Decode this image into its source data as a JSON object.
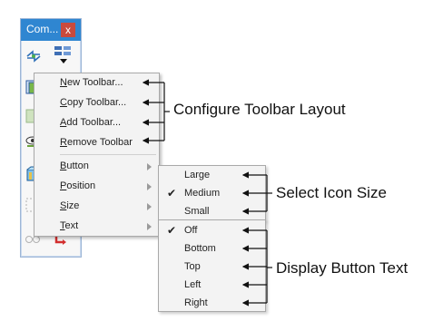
{
  "window": {
    "title": "Com...",
    "close_label": "x"
  },
  "context_menu": {
    "items": [
      {
        "prefix": "",
        "mnemonic": "N",
        "rest": "ew Toolbar..."
      },
      {
        "prefix": "",
        "mnemonic": "C",
        "rest": "opy Toolbar..."
      },
      {
        "prefix": "",
        "mnemonic": "A",
        "rest": "dd Toolbar..."
      },
      {
        "prefix": "",
        "mnemonic": "R",
        "rest": "emove Toolbar"
      },
      {
        "prefix": "",
        "mnemonic": "B",
        "rest": "utton"
      },
      {
        "prefix": "",
        "mnemonic": "P",
        "rest": "osition"
      },
      {
        "prefix": "",
        "mnemonic": "S",
        "rest": "ize"
      },
      {
        "prefix": "",
        "mnemonic": "T",
        "rest": "ext"
      }
    ]
  },
  "icon_size_menu": {
    "items": [
      "Large",
      "Medium",
      "Small"
    ],
    "checked": "Medium"
  },
  "button_text_menu": {
    "items": [
      "Off",
      "Bottom",
      "Top",
      "Left",
      "Right"
    ],
    "checked": "Off"
  },
  "annotations": {
    "configure": "Configure Toolbar Layout",
    "icon_size": "Select Icon Size",
    "button_text": "Display Button Text"
  },
  "colors": {
    "title_bar": "#2f86d1",
    "close_button": "#c94a3d"
  }
}
